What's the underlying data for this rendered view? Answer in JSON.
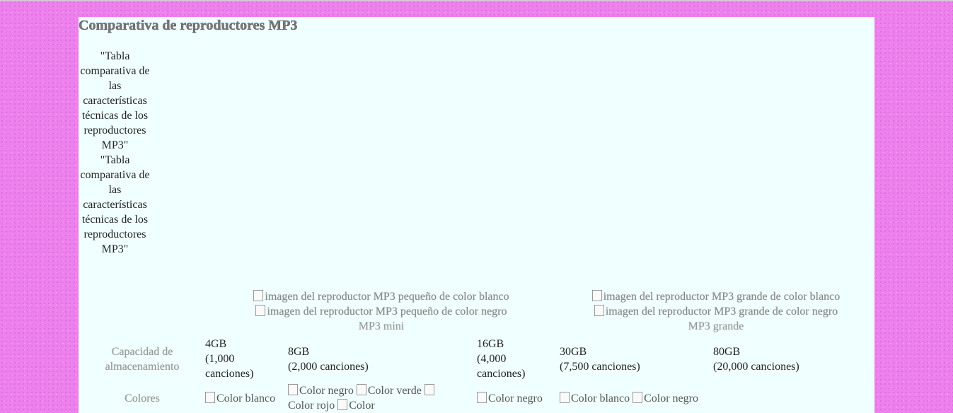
{
  "page": {
    "title": "Comparativa de reproductores MP3",
    "table_caption": [
      "\"Tabla comparativa de las características técnicas de los reproductores MP3\"",
      "\"Tabla comparativa de las características técnicas de los reproductores MP3\""
    ]
  },
  "models": {
    "mini": {
      "img_white": "imagen del reproductor MP3 pequeño de color blanco",
      "img_black": "imagen del reproductor MP3 pequeño de color negro",
      "label": "MP3 mini"
    },
    "grande": {
      "img_white": "imagen del reproductor MP3 grande de color blanco",
      "img_black": "imagen del reproductor MP3 grande de color negro",
      "label": "MP3 grande"
    }
  },
  "rows": {
    "capacity": {
      "label": "Capacidad de almacenamiento",
      "values": [
        {
          "size": "4GB",
          "songs": "(1,000 canciones)"
        },
        {
          "size": "8GB",
          "songs": "(2,000 canciones)"
        },
        {
          "size": "16GB",
          "songs": "(4,000 canciones)"
        },
        {
          "size": "30GB",
          "songs": "(7,500 canciones)"
        },
        {
          "size": "80GB",
          "songs": "(20,000 canciones)"
        }
      ]
    },
    "colors": {
      "label": "Colores",
      "c1": [
        "Color blanco"
      ],
      "c2": [
        "Color negro",
        "Color verde",
        "Color rojo",
        "Color"
      ],
      "c3": [
        "Color negro"
      ],
      "c4": [
        "Color blanco",
        "Color negro"
      ]
    }
  }
}
